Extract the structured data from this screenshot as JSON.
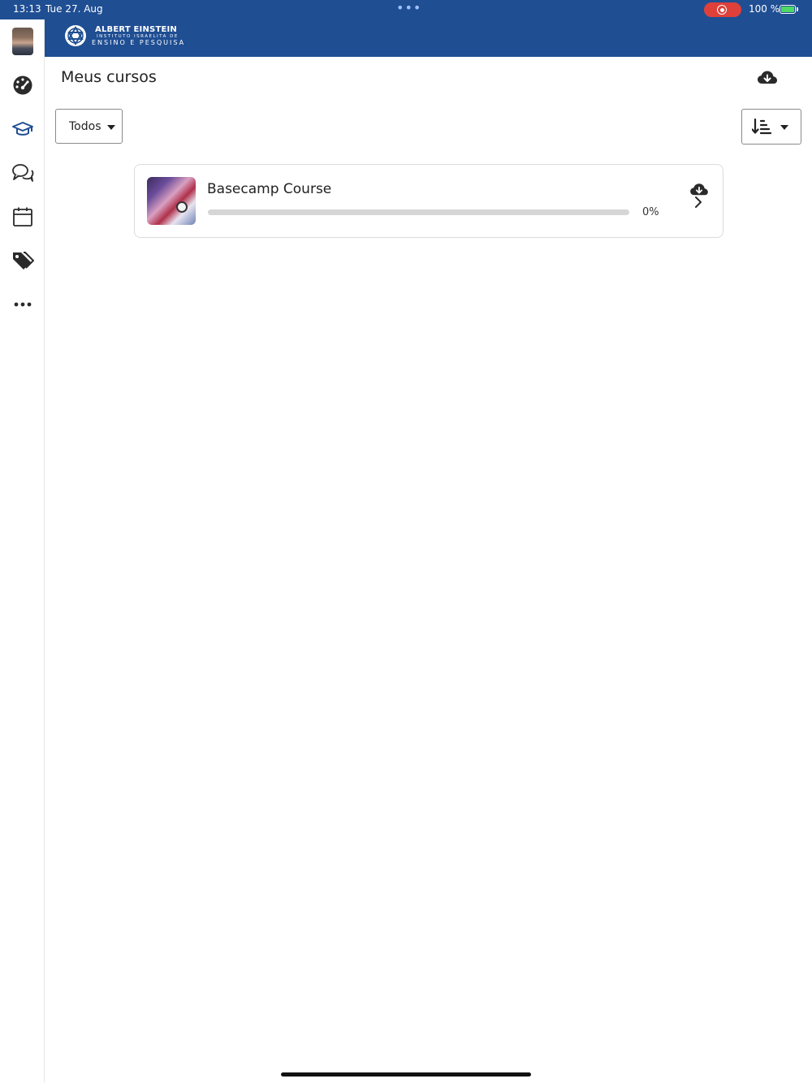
{
  "status_bar": {
    "time": "13:13",
    "date": "Tue 27. Aug",
    "battery": "100 %"
  },
  "brand": {
    "line1": "ALBERT EINSTEIN",
    "line2": "INSTITUTO ISRAELITA DE",
    "line3": "ENSINO E PESQUISA"
  },
  "sidebar": {
    "items": [
      {
        "name": "avatar"
      },
      {
        "name": "dashboard-icon"
      },
      {
        "name": "courses-icon",
        "active": true
      },
      {
        "name": "messages-icon"
      },
      {
        "name": "calendar-icon"
      },
      {
        "name": "tags-icon"
      },
      {
        "name": "more-icon"
      }
    ]
  },
  "main": {
    "title": "Meus cursos",
    "filter": {
      "selected": "Todos"
    },
    "courses": [
      {
        "name": "Basecamp Course",
        "progress_percent": 0,
        "progress_label": "0%"
      }
    ]
  },
  "colors": {
    "brand_blue": "#1f4e93",
    "record_red": "#e0403a",
    "battery_green": "#4cd964"
  }
}
